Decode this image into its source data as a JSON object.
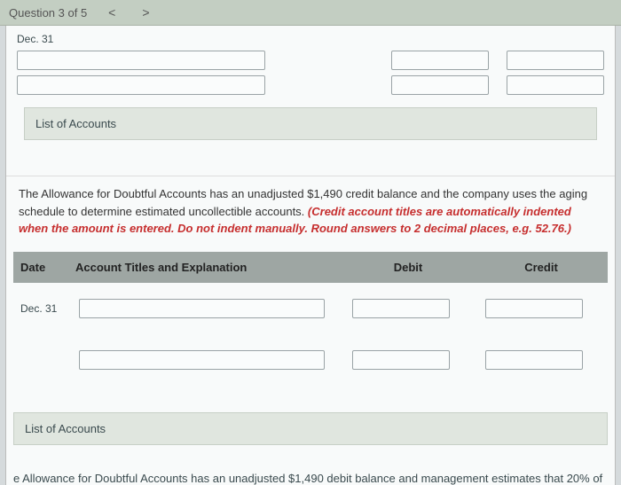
{
  "nav": {
    "question_label": "Question 3 of 5",
    "prev_arrow": "<",
    "next_arrow": ">"
  },
  "prev_section": {
    "date_label": "Dec. 31"
  },
  "list_accounts_1": "List of Accounts",
  "instruction": {
    "plain": "The Allowance for Doubtful Accounts has an unadjusted $1,490 credit balance and the company uses the aging schedule to determine estimated uncollectible accounts. ",
    "red": "(Credit account titles are automatically indented when the amount is entered. Do not indent manually. Round answers to 2 decimal places, e.g. 52.76.)"
  },
  "table": {
    "headers": {
      "date": "Date",
      "title": "Account Titles and Explanation",
      "debit": "Debit",
      "credit": "Credit"
    },
    "row1_date": "Dec. 31"
  },
  "list_accounts_2": "List of Accounts",
  "cutoff": "e Allowance for Doubtful Accounts has an unadjusted $1,490 debit balance and management estimates that 20% of"
}
